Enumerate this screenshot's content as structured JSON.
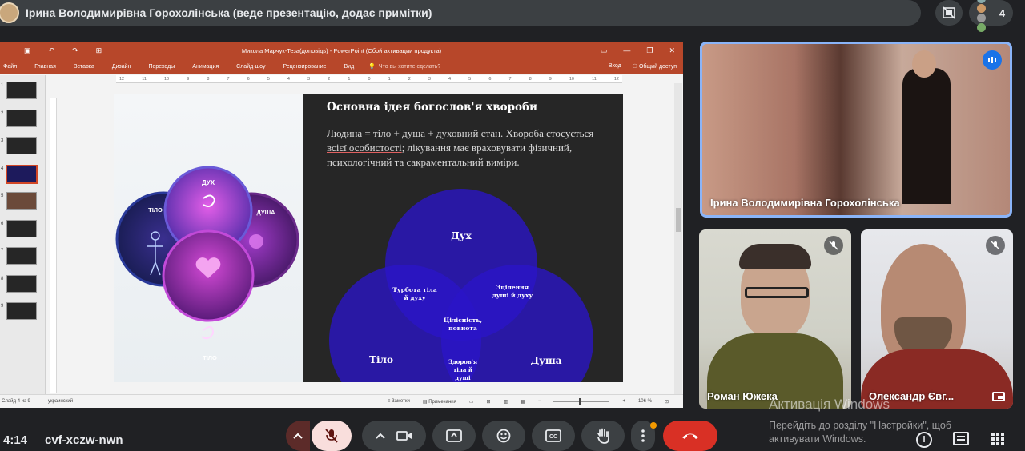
{
  "presenter": {
    "label": "Ірина Володимирівна Горохолінська (веде презентацію, додає примітки)"
  },
  "people": {
    "count": "4"
  },
  "powerpoint": {
    "title": "Микола Марчук-Теза(доповідь) - PowerPoint (Сбой активации продукта)",
    "tabs": [
      "Файл",
      "Главная",
      "Вставка",
      "Дизайн",
      "Переходы",
      "Анимация",
      "Слайд-шоу",
      "Рецензирование",
      "Вид"
    ],
    "tellme": "Что вы хотите сделать?",
    "signin": "Вход",
    "share": "Общий доступ",
    "ruler": [
      "12",
      "11",
      "10",
      "9",
      "8",
      "7",
      "6",
      "5",
      "4",
      "3",
      "2",
      "1",
      "0",
      "1",
      "2",
      "3",
      "4",
      "5",
      "6",
      "7",
      "8",
      "9",
      "10",
      "11",
      "12"
    ],
    "thumb_numbers": [
      "1",
      "2",
      "3",
      "4",
      "5",
      "6",
      "7",
      "8",
      "9"
    ],
    "status": {
      "slide": "Слайд 4 из 9",
      "lang": "украинский",
      "notes": "Заметки",
      "comments": "Примечания",
      "zoom": "106 %"
    }
  },
  "slide": {
    "title": "Основна ідея богослов'я хвороби",
    "body_plain1": "Людина = тіло + душа + духовний стан. ",
    "body_u1": "Хвороба",
    "body_plain2": " стосується ",
    "body_u2": "всієї особистості",
    "body_plain3": "; лікування має враховувати фізичний, психологічний та сакраментальний виміри.",
    "left_image_labels": {
      "spirit": "ДУХ",
      "body": "ТІЛО",
      "soul": "ДУША",
      "bottom": "ТІЛО"
    },
    "venn": {
      "spirit": "Дух",
      "body": "Тіло",
      "soul": "Душа",
      "body_spirit": [
        "Турбота тіла",
        "й духу"
      ],
      "spirit_soul": [
        "Зцілення",
        "душі й духу"
      ],
      "center": [
        "Цілісність,",
        "повнота"
      ],
      "body_soul": [
        "Здоров'я",
        "тіла й",
        "душі"
      ]
    }
  },
  "tiles": {
    "main": {
      "name": "Ірина Володимирівна Горохолінська"
    },
    "roman": {
      "name": "Роман Южека"
    },
    "oleksandr": {
      "name": "Олександр Євг..."
    }
  },
  "bottom": {
    "time": "4:14",
    "code": "cvf-xczw-nwn"
  },
  "windows_activation": {
    "title": "Активація Windows",
    "line1": "Перейдіть до розділу \"Настройки\", щоб",
    "line2": "активувати Windows."
  },
  "colors": {
    "pp_red": "#b7472a",
    "end_call": "#d93025",
    "mic_off": "#f9dedc",
    "meet_bg": "#202124",
    "venn_blue": "#2a14c8"
  }
}
